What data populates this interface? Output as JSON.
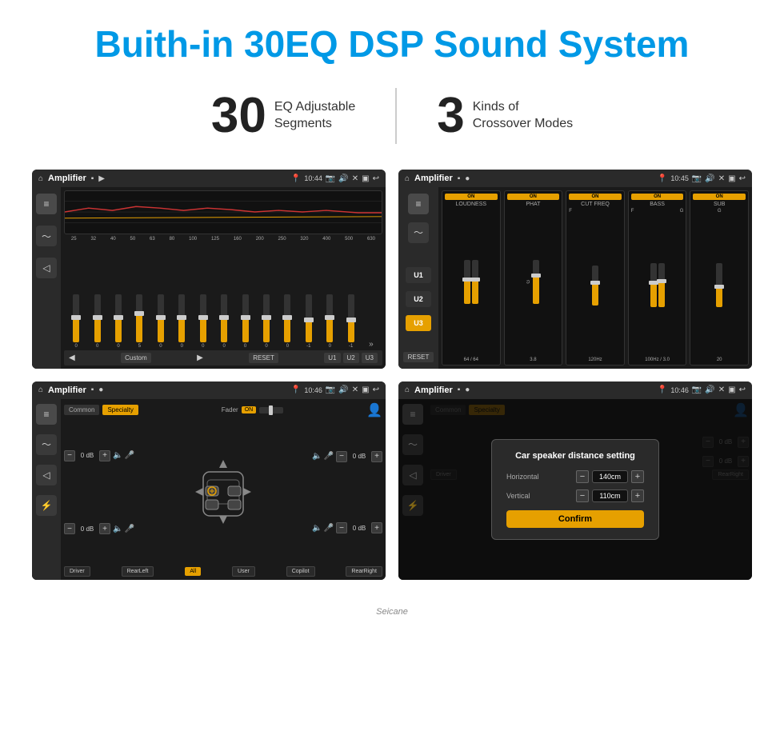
{
  "header": {
    "title": "Buith-in 30EQ DSP Sound System"
  },
  "stats": [
    {
      "number": "30",
      "label": "EQ Adjustable\nSegments"
    },
    {
      "number": "3",
      "label": "Kinds of\nCrossover Modes"
    }
  ],
  "screen1": {
    "status_bar": {
      "title": "Amplifier",
      "time": "10:44"
    },
    "eq_labels": [
      "25",
      "32",
      "40",
      "50",
      "63",
      "80",
      "100",
      "125",
      "160",
      "200",
      "250",
      "320",
      "400",
      "500",
      "630"
    ],
    "eq_values": [
      "0",
      "0",
      "0",
      "5",
      "0",
      "0",
      "0",
      "0",
      "0",
      "0",
      "0",
      "-1",
      "0",
      "-1"
    ],
    "bottom": {
      "custom": "Custom",
      "reset": "RESET",
      "u1": "U1",
      "u2": "U2",
      "u3": "U3"
    }
  },
  "screen2": {
    "status_bar": {
      "title": "Amplifier",
      "time": "10:45"
    },
    "presets": [
      "U1",
      "U2",
      "U3"
    ],
    "active_preset": "U3",
    "channels": [
      "LOUDNESS",
      "PHAT",
      "CUT FREQ",
      "BASS",
      "SUB"
    ],
    "reset_label": "RESET"
  },
  "screen3": {
    "status_bar": {
      "title": "Amplifier",
      "time": "10:46"
    },
    "common_btn": "Common",
    "specialty_btn": "Specialty",
    "fader_label": "Fader",
    "fader_on": "ON",
    "controls": {
      "tl_db": "0 dB",
      "tr_db": "0 dB",
      "bl_db": "0 dB",
      "br_db": "0 dB"
    },
    "bottom_btns": [
      "Driver",
      "RearLeft",
      "All",
      "User",
      "Copilot",
      "RearRight"
    ]
  },
  "screen4": {
    "status_bar": {
      "title": "Amplifier",
      "time": "10:46"
    },
    "common_btn": "Common",
    "specialty_btn": "Specialty",
    "dialog": {
      "title": "Car speaker distance setting",
      "horizontal_label": "Horizontal",
      "horizontal_value": "140cm",
      "vertical_label": "Vertical",
      "vertical_value": "110cm",
      "confirm_btn": "Confirm"
    },
    "bottom_btns": {
      "driver": "Driver",
      "rear_left": "RearLeft",
      "copilot": "Copilot",
      "rear_right": "RearRight"
    },
    "right_controls": {
      "db1": "0 dB",
      "db2": "0 dB"
    }
  },
  "watermark": "Seicane"
}
